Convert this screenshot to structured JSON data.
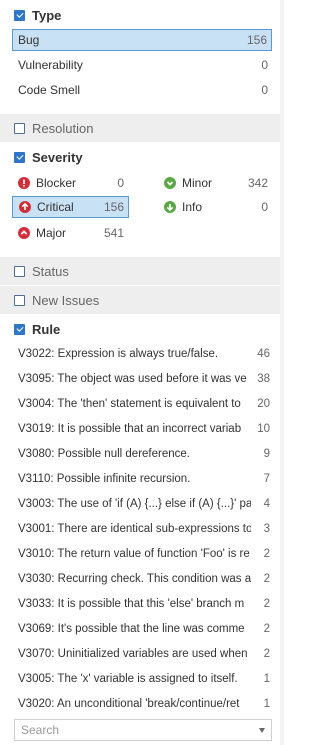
{
  "type_section": {
    "title": "Type",
    "items": [
      {
        "label": "Bug",
        "count": "156"
      },
      {
        "label": "Vulnerability",
        "count": "0"
      },
      {
        "label": "Code Smell",
        "count": "0"
      }
    ]
  },
  "resolution_section": {
    "title": "Resolution"
  },
  "severity_section": {
    "title": "Severity",
    "blocker": {
      "label": "Blocker",
      "count": "0",
      "icon": "blocker-icon",
      "color": "#d02f3a"
    },
    "minor": {
      "label": "Minor",
      "count": "342",
      "icon": "minor-icon",
      "color": "#4b9fd5"
    },
    "critical": {
      "label": "Critical",
      "count": "156",
      "icon": "critical-icon",
      "color": "#d02f3a"
    },
    "info": {
      "label": "Info",
      "count": "0",
      "icon": "info-icon",
      "color": "#4b9fd5"
    },
    "major": {
      "label": "Major",
      "count": "541",
      "icon": "major-icon",
      "color": "#d02f3a"
    }
  },
  "status_section": {
    "title": "Status"
  },
  "new_issues_section": {
    "title": "New Issues"
  },
  "rule_section": {
    "title": "Rule",
    "items": [
      {
        "label": "V3022: Expression is always true/false.",
        "count": "46"
      },
      {
        "label": "V3095: The object was used before it was ve",
        "count": "38"
      },
      {
        "label": "V3004: The 'then' statement is equivalent to",
        "count": "20"
      },
      {
        "label": "V3019: It is possible that an incorrect variab",
        "count": "10"
      },
      {
        "label": "V3080: Possible null dereference.",
        "count": "9"
      },
      {
        "label": "V3110: Possible infinite recursion.",
        "count": "7"
      },
      {
        "label": "V3003: The use of 'if (A) {...} else if (A) {...}' pat",
        "count": "4"
      },
      {
        "label": "V3001: There are identical sub-expressions to",
        "count": "3"
      },
      {
        "label": "V3010: The return value of function 'Foo' is re",
        "count": "2"
      },
      {
        "label": "V3030: Recurring check. This condition was a",
        "count": "2"
      },
      {
        "label": "V3033: It is possible that this 'else' branch m",
        "count": "2"
      },
      {
        "label": "V3069: It's possible that the line was comme",
        "count": "2"
      },
      {
        "label": "V3070: Uninitialized variables are used when",
        "count": "2"
      },
      {
        "label": "V3005: The 'x' variable is assigned to itself.",
        "count": "1"
      },
      {
        "label": "V3020: An unconditional 'break/continue/ret",
        "count": "1"
      }
    ]
  },
  "search": {
    "placeholder": "Search"
  },
  "colors": {
    "accent": "#2f76c8",
    "selected_bg": "#c9e1f4",
    "selected_border": "#5a9ad0"
  }
}
